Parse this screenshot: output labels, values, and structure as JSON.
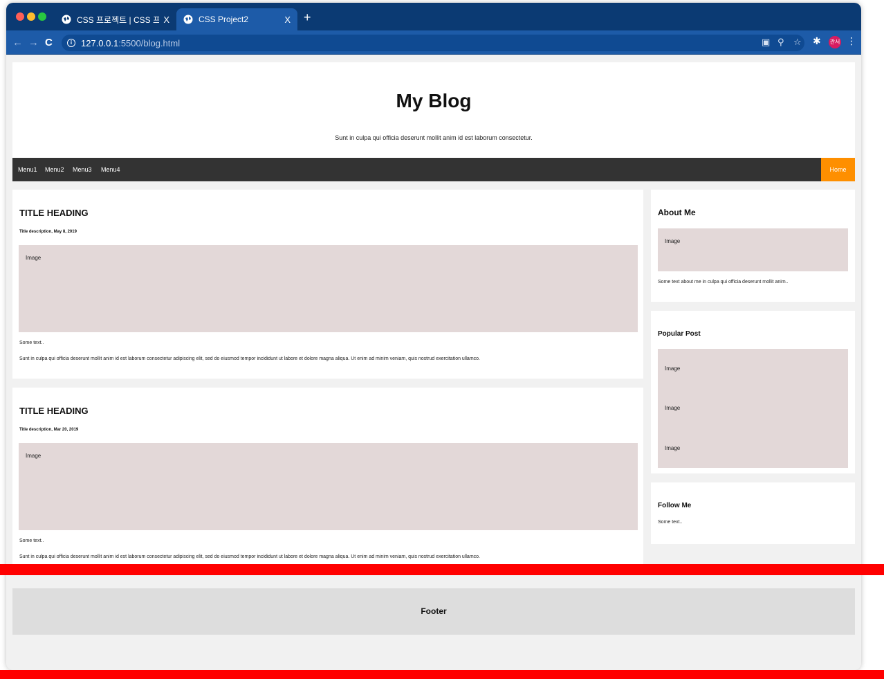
{
  "browser": {
    "tabs": [
      {
        "title": "CSS 프로젝트 | CSS 프로그래밍 기",
        "close": "X"
      },
      {
        "title": "CSS Project2",
        "close": "X"
      }
    ],
    "new_tab": "+",
    "url_host": "127.0.0.1",
    "url_path": ":5500/blog.html",
    "profile_label": "관서"
  },
  "header": {
    "title": "My Blog",
    "subtitle": "Sunt in culpa qui officia deserunt mollit anim id est laborum consectetur."
  },
  "nav": {
    "items": [
      "Menu1",
      "Menu2",
      "Menu3",
      "Menu4"
    ],
    "home": "Home"
  },
  "posts": [
    {
      "title": "TITLE HEADING",
      "description": "Title description, May 8, 2019",
      "image_label": "Image",
      "short_text": "Some text..",
      "body": "Sunt in culpa qui officia deserunt mollit anim id est laborum consectetur adipiscing elit, sed do eiusmod tempor incididunt ut labore et dolore magna aliqua. Ut enim ad minim veniam, quis nostrud exercitation ullamco."
    },
    {
      "title": "TITLE HEADING",
      "description": "Title description, Mar 20, 2019",
      "image_label": "Image",
      "short_text": "Some text..",
      "body": "Sunt in culpa qui officia deserunt mollit anim id est laborum consectetur adipiscing elit, sed do eiusmod tempor incididunt ut labore et dolore magna aliqua. Ut enim ad minim veniam, quis nostrud exercitation ullamco."
    }
  ],
  "sidebar": {
    "about": {
      "title": "About Me",
      "image_label": "Image",
      "text": "Some text about me in culpa qui officia deserunt mollit anim.."
    },
    "popular": {
      "title": "Popular Post",
      "images": [
        "Image",
        "Image",
        "Image"
      ]
    },
    "follow": {
      "title": "Follow Me",
      "text": "Some text.."
    }
  },
  "footer": {
    "label": "Footer"
  },
  "colors": {
    "tabbar": "#0b3a73",
    "toolbar": "#1d5ba8",
    "nav_bg": "#333333",
    "home_accent": "#fe8f00",
    "image_placeholder": "#e3d8d8",
    "highlight_bar": "#ff0000"
  }
}
